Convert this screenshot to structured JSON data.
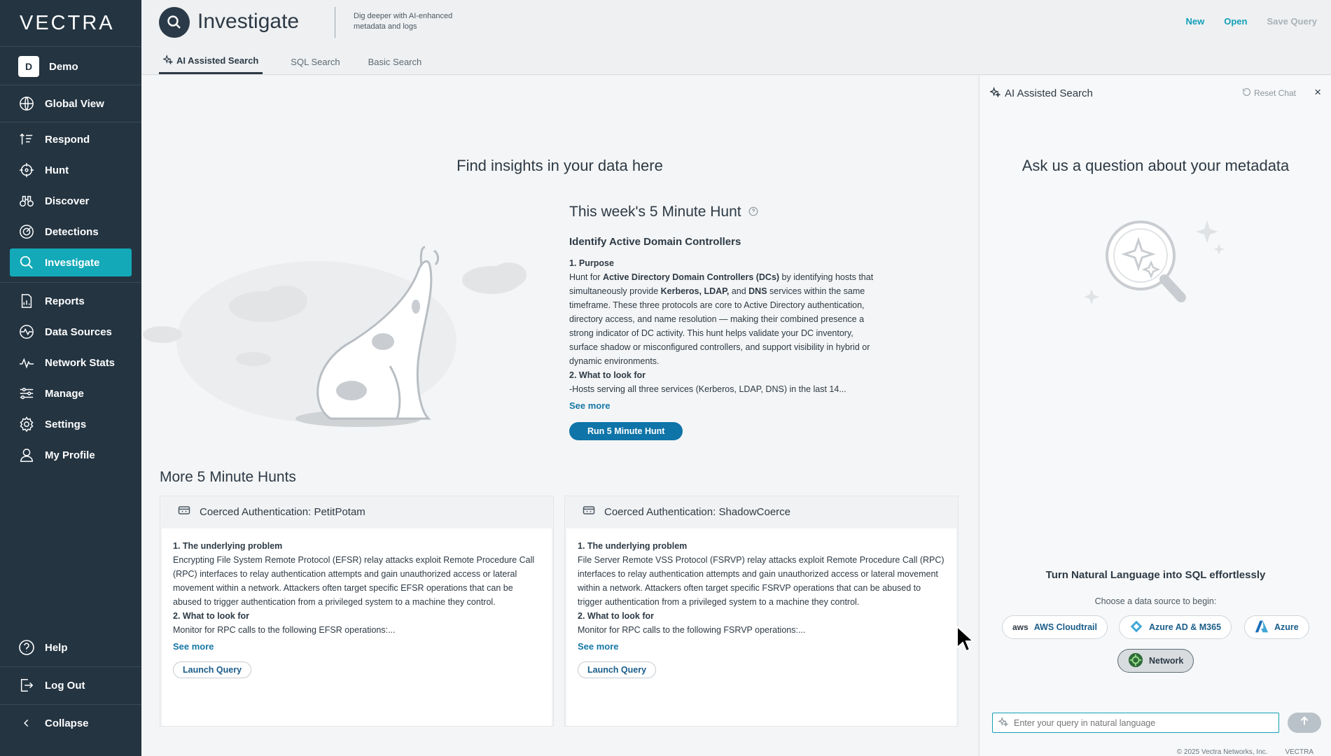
{
  "sidebar": {
    "brand": "VECTRA",
    "demo": {
      "badge": "D",
      "label": "Demo"
    },
    "items": [
      {
        "label": "Global View",
        "icon": "globe-icon"
      },
      {
        "label": "Respond",
        "icon": "respond-icon"
      },
      {
        "label": "Hunt",
        "icon": "crosshair-icon"
      },
      {
        "label": "Discover",
        "icon": "binoculars-icon"
      },
      {
        "label": "Detections",
        "icon": "detections-icon"
      },
      {
        "label": "Investigate",
        "icon": "search-icon",
        "active": true
      },
      {
        "label": "Reports",
        "icon": "report-icon"
      },
      {
        "label": "Data Sources",
        "icon": "data-sources-icon"
      },
      {
        "label": "Network Stats",
        "icon": "network-stats-icon"
      },
      {
        "label": "Manage",
        "icon": "manage-icon"
      },
      {
        "label": "Settings",
        "icon": "gear-icon"
      },
      {
        "label": "My Profile",
        "icon": "user-icon"
      }
    ],
    "bottom": [
      {
        "label": "Help",
        "icon": "help-icon"
      },
      {
        "label": "Log Out",
        "icon": "logout-icon"
      },
      {
        "label": "Collapse",
        "icon": "chevron-left-icon"
      }
    ]
  },
  "header": {
    "title": "Investigate",
    "subtitle": "Dig deeper with AI-enhanced metadata and logs",
    "actions": {
      "new": "New",
      "open": "Open",
      "save": "Save Query"
    },
    "tabs": [
      "AI Assisted Search",
      "SQL Search",
      "Basic Search"
    ]
  },
  "main": {
    "hero_title": "Find insights in your data here",
    "hunt": {
      "title": "This week's 5 Minute Hunt",
      "subtitle": "Identify Active Domain Controllers",
      "purpose_heading": "1. Purpose",
      "purpose_1": "Hunt for ",
      "purpose_b1": "Active Directory Domain Controllers (DCs)",
      "purpose_2": " by identifying hosts that simultaneously provide ",
      "purpose_b2": "Kerberos, LDAP,",
      "purpose_3": " and ",
      "purpose_b3": "DNS",
      "purpose_4": " services within the same timeframe. These three protocols are core to Active Directory authentication, directory access, and name resolution — making their combined presence a strong indicator of DC activity. This hunt helps validate your DC inventory, surface shadow or misconfigured controllers, and support visibility in hybrid or dynamic environments.",
      "look_heading": "2. What to look for",
      "look_text": "-Hosts serving all three services (Kerberos, LDAP, DNS) in the last 14...",
      "see_more": "See more",
      "run_button": "Run 5 Minute Hunt"
    },
    "more_title": "More 5 Minute Hunts",
    "cards": [
      {
        "title": "Coerced Authentication: PetitPotam",
        "problem_heading": "1. The underlying problem",
        "problem": "Encrypting File System Remote Protocol (EFSR) relay attacks exploit Remote Procedure Call (RPC) interfaces to relay authentication attempts and gain unauthorized access or lateral movement within a network. Attackers often target specific EFSR operations that can be abused to trigger authentication from a privileged system to a machine they control.",
        "look_heading": "2. What to look for",
        "look": "Monitor for RPC calls to the following EFSR operations:...",
        "see_more": "See more",
        "launch": "Launch Query"
      },
      {
        "title": "Coerced Authentication: ShadowCoerce",
        "problem_heading": "1. The underlying problem",
        "problem": "File Server Remote VSS Protocol (FSRVP) relay attacks exploit Remote Procedure Call (RPC) interfaces to relay authentication attempts and gain unauthorized access or lateral movement within a network. Attackers often target specific FSRVP operations that can be abused to trigger authentication from a privileged system to a machine they control.",
        "look_heading": "2. What to look for",
        "look": "Monitor for RPC calls to the following FSRVP operations:...",
        "see_more": "See more",
        "launch": "Launch Query"
      }
    ]
  },
  "panel": {
    "title": "AI Assisted Search",
    "reset": "Reset Chat",
    "close": "×",
    "ask": "Ask us a question about your metadata",
    "nl_title": "Turn Natural Language into SQL effortlessly",
    "nl_sub": "Choose a data source to begin:",
    "sources": {
      "aws_logo": "aws",
      "aws": "AWS Cloudtrail",
      "azure_ad": "Azure AD & M365",
      "azure": "Azure",
      "network": "Network"
    },
    "query_placeholder": "Enter your query in natural language"
  },
  "footer": {
    "copyright": "© 2025 Vectra Networks, Inc.",
    "brand": "VECTRA"
  },
  "colors": {
    "sidebar": "#243441",
    "accent": "#13a9b8",
    "primary_button": "#0f74a8",
    "link": "#1677a6"
  }
}
